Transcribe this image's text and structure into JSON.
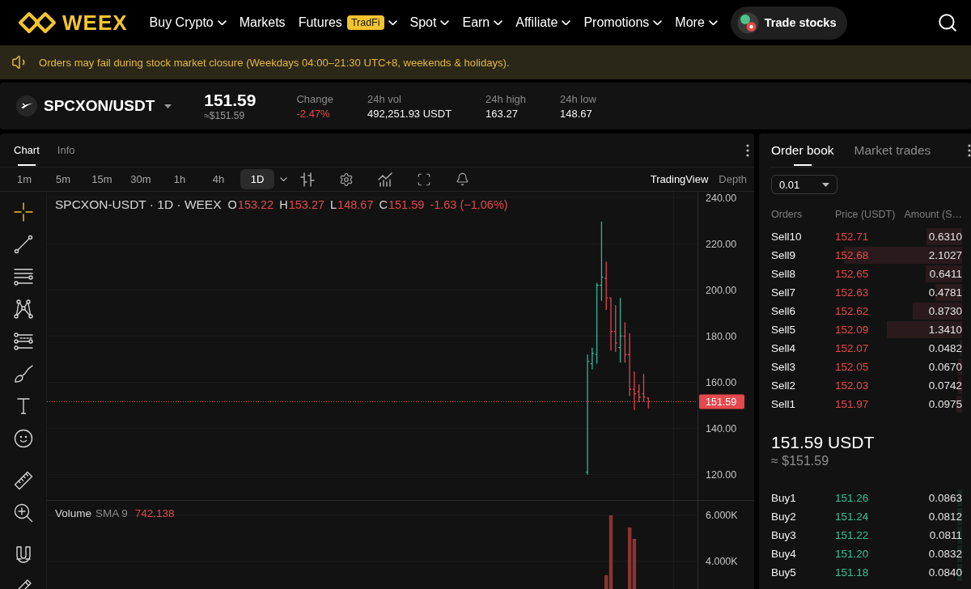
{
  "nav": {
    "logo": "WEEX",
    "items": [
      {
        "label": "Buy Crypto",
        "has_menu": true
      },
      {
        "label": "Markets",
        "has_menu": false
      },
      {
        "label": "Futures",
        "badge": "TradFi",
        "has_menu": true
      },
      {
        "label": "Spot",
        "has_menu": true
      },
      {
        "label": "Earn",
        "has_menu": true
      },
      {
        "label": "Affiliate",
        "has_menu": true
      },
      {
        "label": "Promotions",
        "has_menu": true
      },
      {
        "label": "More",
        "has_menu": true
      }
    ],
    "trade_button": "Trade stocks"
  },
  "notice": "Orders may fail during stock market closure (Weekdays 04:00–21:30 UTC+8, weekends & holidays).",
  "ticker": {
    "pair": "SPCXON/USDT",
    "price": "151.59",
    "price_usd": "≈$151.59",
    "stats": [
      {
        "label": "Change",
        "value": "-2.47%",
        "falling": true
      },
      {
        "label": "24h vol",
        "value": "492,251.93 USDT",
        "falling": false
      },
      {
        "label": "24h high",
        "value": "163.27",
        "falling": false
      },
      {
        "label": "24h low",
        "value": "148.67",
        "falling": false
      }
    ]
  },
  "chart_panel": {
    "tabs": [
      {
        "label": "Chart",
        "selected": true
      },
      {
        "label": "Info",
        "selected": false
      }
    ],
    "intervals": [
      {
        "label": "1m",
        "selected": false
      },
      {
        "label": "5m",
        "selected": false
      },
      {
        "label": "15m",
        "selected": false
      },
      {
        "label": "30m",
        "selected": false
      },
      {
        "label": "1h",
        "selected": false
      },
      {
        "label": "4h",
        "selected": false
      },
      {
        "label": "1D",
        "selected": true
      }
    ],
    "views": [
      {
        "label": "TradingView",
        "selected": true
      },
      {
        "label": "Depth",
        "selected": false
      }
    ],
    "tool_groups": [
      {
        "tools": [
          {
            "selected": true
          },
          {
            "selected": false
          },
          {
            "selected": false
          },
          {
            "selected": false
          },
          {
            "selected": false
          },
          {
            "selected": false
          },
          {
            "selected": false
          },
          {
            "selected": false
          }
        ]
      },
      {
        "tools": [
          {
            "selected": false
          },
          {
            "selected": false
          }
        ]
      },
      {
        "tools": [
          {
            "selected": false
          },
          {
            "selected": false
          }
        ]
      }
    ],
    "legend": {
      "title": "SPCXON-USDT · 1D · WEEX",
      "ohlc": [
        {
          "label": "O",
          "value": "153.22"
        },
        {
          "label": "H",
          "value": "153.27"
        },
        {
          "label": "L",
          "value": "148.67"
        },
        {
          "label": "C",
          "value": "151.59"
        }
      ],
      "change": "-1.63 (−1.06%)"
    },
    "price_chart": {
      "axis_labels": [
        "240.00",
        "220.00",
        "200.00",
        "180.00",
        "160.00",
        "140.00",
        "120.00"
      ],
      "last_price": "151.59"
    },
    "volume": {
      "label": "Volume",
      "indicator": "SMA 9",
      "value": "742.138",
      "axis_labels": [
        "6.000K",
        "4.000K"
      ]
    }
  },
  "order_book": {
    "tabs": [
      {
        "label": "Order book",
        "selected": true
      },
      {
        "label": "Market trades",
        "selected": false
      }
    ],
    "precision": "0.01",
    "columns": [
      "Orders",
      "Price (USDT)",
      "Amount (S…"
    ],
    "asks": [
      {
        "name": "Sell10",
        "price": "152.71",
        "amount": "0.6310",
        "level": 0.186
      },
      {
        "name": "Sell9",
        "price": "152.68",
        "amount": "2.1027",
        "level": 0.62
      },
      {
        "name": "Sell8",
        "price": "152.65",
        "amount": "0.6411",
        "level": 0.189
      },
      {
        "name": "Sell7",
        "price": "152.63",
        "amount": "0.4781",
        "level": 0.141
      },
      {
        "name": "Sell6",
        "price": "152.62",
        "amount": "0.8730",
        "level": 0.257
      },
      {
        "name": "Sell5",
        "price": "152.09",
        "amount": "1.3410",
        "level": 0.396
      },
      {
        "name": "Sell4",
        "price": "152.07",
        "amount": "0.0482",
        "level": 0.014
      },
      {
        "name": "Sell3",
        "price": "152.05",
        "amount": "0.0670",
        "level": 0.02
      },
      {
        "name": "Sell2",
        "price": "152.03",
        "amount": "0.0742",
        "level": 0.022
      },
      {
        "name": "Sell1",
        "price": "151.97",
        "amount": "0.0975",
        "level": 0.029
      }
    ],
    "mid_price": "151.59 USDT",
    "mid_price_usd": "≈ $151.59",
    "bids": [
      {
        "name": "Buy1",
        "price": "151.26",
        "amount": "0.0863",
        "level": 0.025
      },
      {
        "name": "Buy2",
        "price": "151.24",
        "amount": "0.0812",
        "level": 0.024
      },
      {
        "name": "Buy3",
        "price": "151.22",
        "amount": "0.0811",
        "level": 0.024
      },
      {
        "name": "Buy4",
        "price": "151.20",
        "amount": "0.0832",
        "level": 0.025
      },
      {
        "name": "Buy5",
        "price": "151.18",
        "amount": "0.0840",
        "level": 0.025
      }
    ]
  }
}
